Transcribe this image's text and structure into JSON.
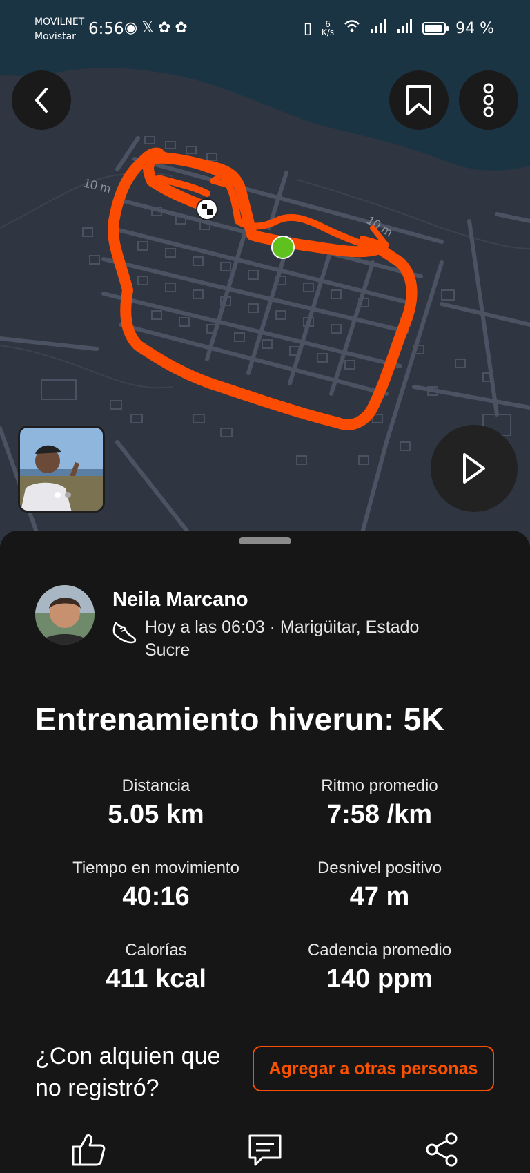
{
  "status_bar": {
    "carrier_1": "MOVILNET",
    "carrier_2": "Movistar",
    "time": "6:56",
    "net_speed_value": "6",
    "net_speed_unit": "K/s",
    "battery": "94 %"
  },
  "map": {
    "contour_label_1": "10 m",
    "contour_label_2": "10 m",
    "route_color": "#fc4c02",
    "start_color": "#5fc11e"
  },
  "athlete": {
    "name": "Neila Marcano",
    "meta": "Hoy a las 06:03 · Marigüitar, Estado Sucre"
  },
  "activity": {
    "title": "Entrenamiento hiverun: 5K"
  },
  "stats": [
    {
      "label": "Distancia",
      "value": "5.05 km"
    },
    {
      "label": "Ritmo promedio",
      "value": "7:58 /km"
    },
    {
      "label": "Tiempo en movimiento",
      "value": "40:16"
    },
    {
      "label": "Desnivel positivo",
      "value": "47 m"
    },
    {
      "label": "Calorías",
      "value": "411 kcal"
    },
    {
      "label": "Cadencia promedio",
      "value": "140 ppm"
    }
  ],
  "tagging": {
    "question": "¿Con alquien que no registró?",
    "button_label": "Agregar a otras personas"
  },
  "icons": {
    "back": "chevron-left-icon",
    "save": "bookmark-icon",
    "more": "more-vertical-icon",
    "play": "play-icon",
    "like": "thumbs-up-icon",
    "comment": "comment-icon",
    "share": "share-icon"
  },
  "accent_color": "#fc4c02"
}
